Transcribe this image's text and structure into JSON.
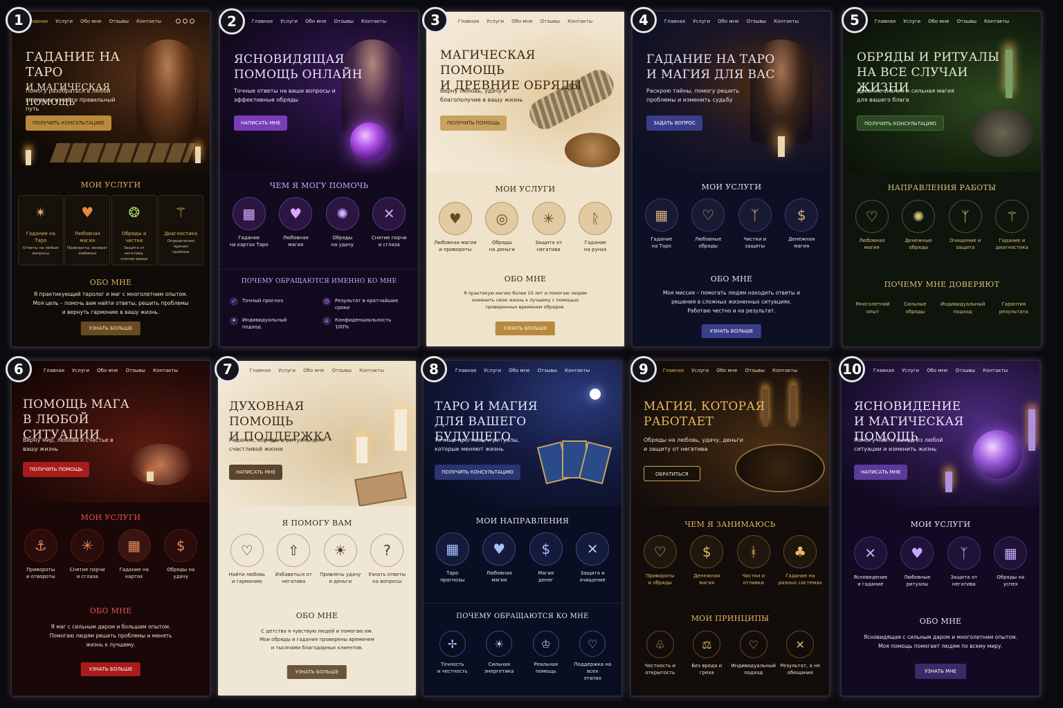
{
  "cards": [
    {
      "number": "1",
      "nav": [
        "Главная",
        "Услуги",
        "Обо мне",
        "Отзывы",
        "Контакты"
      ],
      "title_line1": "Гадание на Таро",
      "title_line2": "и магическая помощь",
      "subtitle": "Помогу разобраться в любой ситуации и найти правильный путь",
      "cta": "Получить консультацию",
      "services_title": "Мои услуги",
      "services": [
        {
          "label": "Гадание на Таро",
          "desc": "Ответы на любые\nвопросы",
          "icon": "tarot-icon"
        },
        {
          "label": "Любовная магия",
          "desc": "Привороты, возврат\nлюбимых",
          "icon": "heart-icon"
        },
        {
          "label": "Обряды и чистки",
          "desc": "Защита от негатива,\nснятие вреда",
          "icon": "ritual-icon"
        },
        {
          "label": "Диагностика",
          "desc": "Определение причин\nпроблем",
          "icon": "diagnostics-icon"
        }
      ],
      "about_title": "Обо мне",
      "about_text": "Я практикующий таролог и маг с многолетним опытом.\nМоя цель – помочь вам найти ответы, решить проблемы\nи вернуть гармонию в вашу жизнь.",
      "more": "Узнать больше"
    },
    {
      "number": "2",
      "nav": [
        "Главная",
        "Услуги",
        "Обо мне",
        "Отзывы",
        "Контакты"
      ],
      "title_line1": "Ясновидящая",
      "title_line2": "помощь онлайн",
      "subtitle": "Точные ответы на ваши вопросы и эффективные обряды",
      "cta": "Написать мне",
      "services_title": "Чем я могу помочь",
      "services": [
        {
          "label": "Гадание\nна картах Таро",
          "icon": "tarot-icon"
        },
        {
          "label": "Любовная\nмагия",
          "icon": "heart-icon"
        },
        {
          "label": "Обряды\nна удачу",
          "icon": "luck-icon"
        },
        {
          "label": "Снятие порчи\nи сглаза",
          "icon": "arrows-icon"
        }
      ],
      "why_title": "Почему обращаются именно ко мне",
      "reasons": [
        "Точный прогноз",
        "Результат в кратчайшие сроки",
        "Индивидуальный\nподход",
        "Конфиденциальность\n100%"
      ]
    },
    {
      "number": "3",
      "nav": [
        "Главная",
        "Услуги",
        "Обо мне",
        "Отзывы",
        "Контакты"
      ],
      "title_line1": "Магическая помощь",
      "title_line2": "и древние обряды",
      "subtitle": "Верну любовь, удачу и благополучие в вашу жизнь",
      "cta": "Получить помощь",
      "services_title": "Мои услуги",
      "services": [
        {
          "label": "Любовная магия\nи привороты",
          "icon": "heart-icon"
        },
        {
          "label": "Обряды\nна деньги",
          "icon": "money-icon"
        },
        {
          "label": "Защита от\nнегатива",
          "icon": "shield-icon"
        },
        {
          "label": "Гадание\nна рунах",
          "icon": "rune-icon"
        }
      ],
      "about_title": "Обо мне",
      "about_text": "Я практикую магию более 10 лет и помогаю людям\nизменить свою жизнь к лучшему с помощью\nпроверенных временем обрядов.",
      "more": "Узнать больше"
    },
    {
      "number": "4",
      "nav": [
        "Главная",
        "Услуги",
        "Обо мне",
        "Отзывы",
        "Контакты"
      ],
      "title_line1": "Гадание на Таро",
      "title_line2": "и магия для вас",
      "subtitle": "Раскрою тайны, помогу решить проблемы и изменить судьбу",
      "cta": "Задать вопрос",
      "services_title": "Мои услуги",
      "services": [
        {
          "label": "Гадание\nна Таро",
          "icon": "tarot-icon"
        },
        {
          "label": "Любовные\nобряды",
          "icon": "heart-icon"
        },
        {
          "label": "Чистки и\nзащиты",
          "icon": "shield-icon"
        },
        {
          "label": "Денежная\nмагия",
          "icon": "money-icon"
        }
      ],
      "about_title": "Обо мне",
      "about_text": "Моя миссия – помогать людям находить ответы и\nрешения в сложных жизненных ситуациях.\nРаботаю честно и на результат.",
      "more": "Узнать больше"
    },
    {
      "number": "5",
      "nav": [
        "Главная",
        "Услуги",
        "Обо мне",
        "Отзывы",
        "Контакты"
      ],
      "title_line1": "Обряды и ритуалы",
      "title_line2": "на все случаи жизни",
      "subtitle": "Древние знания и сильная магия для вашего блага",
      "cta": "Получить консультацию",
      "services_title": "Направления работы",
      "services": [
        {
          "label": "Любовная\nмагия",
          "icon": "heart-icon"
        },
        {
          "label": "Денежные\nобряды",
          "icon": "money-icon"
        },
        {
          "label": "Очищение и\nзащита",
          "icon": "shield-icon"
        },
        {
          "label": "Гадание и\nдиагностика",
          "icon": "diagnostics-icon"
        }
      ],
      "why_title": "Почему мне доверяют",
      "trust": [
        "Многолетний\nопыт",
        "Сильные\nобряды",
        "Индивидуальный\nподход",
        "Гарантия\nрезультата"
      ]
    },
    {
      "number": "6",
      "nav": [
        "Главная",
        "Услуги",
        "Обо мне",
        "Отзывы",
        "Контакты"
      ],
      "title_line1": "Помощь мага",
      "title_line2": "в любой ситуации",
      "subtitle": "Верну мир, любовь и счастье в вашу жизнь",
      "cta": "Получить помощь",
      "services_title": "Мои услуги",
      "services": [
        {
          "label": "Привороты\nи отвороты",
          "icon": "ritual-icon"
        },
        {
          "label": "Снятие порчи\nи сглаза",
          "icon": "arrows-icon"
        },
        {
          "label": "Гадание на\nкартах",
          "icon": "tarot-icon"
        },
        {
          "label": "Обряды на\nудачу",
          "icon": "money-icon"
        }
      ],
      "about_title": "Обо мне",
      "about_text": "Я маг с сильным даром и большим опытом.\nПомогаю людям решать проблемы и менять\nжизнь к лучшему.",
      "more": "Узнать больше"
    },
    {
      "number": "7",
      "nav": [
        "Главная",
        "Услуги",
        "Обо мне",
        "Отзывы",
        "Контакты"
      ],
      "title_line1": "Духовная помощь",
      "title_line2": "и поддержка",
      "subtitle": "Гадание, обряды и ритуалы для счастливой жизни",
      "cta": "Написать мне",
      "services_title": "Я помогу вам",
      "services": [
        {
          "label": "Найти любовь\nи гармонию",
          "icon": "heart-icon"
        },
        {
          "label": "Избавиться от\nнегатива",
          "icon": "shield-icon"
        },
        {
          "label": "Привлечь удачу\nи деньги",
          "icon": "sun-icon"
        },
        {
          "label": "Узнать ответы\nна вопросы",
          "icon": "question-icon"
        }
      ],
      "about_title": "Обо мне",
      "about_text": "С детства я чувствую людей и помогаю им.\nМои обряды и гадания проверены временем\nи тысячами благодарных клиентов.",
      "more": "Узнать больше"
    },
    {
      "number": "8",
      "nav": [
        "Главная",
        "Услуги",
        "Обо мне",
        "Отзывы",
        "Контакты"
      ],
      "title_line1": "Таро и магия",
      "title_line2": "для вашего будущего",
      "subtitle": "Точные прогнозы и ритуалы, которые меняют жизнь",
      "cta": "Получить консультацию",
      "services_title": "Мои направления",
      "services": [
        {
          "label": "Таро\nпрогнозы",
          "icon": "tarot-icon"
        },
        {
          "label": "Любовная\nмагия",
          "icon": "heart-icon"
        },
        {
          "label": "Магия\nденег",
          "icon": "money-icon"
        },
        {
          "label": "Защита и\nочищение",
          "icon": "arrows-icon"
        }
      ],
      "why_title": "Почему обращаются ко мне",
      "why": [
        {
          "label": "Точность\nи честность",
          "icon": "compass-icon"
        },
        {
          "label": "Сильная\nэнергетика",
          "icon": "sun-icon"
        },
        {
          "label": "Реальная\nпомощь",
          "icon": "crown-icon"
        },
        {
          "label": "Поддержка на всех\nэтапах",
          "icon": "heart-icon"
        }
      ]
    },
    {
      "number": "9",
      "nav": [
        "Главная",
        "Услуги",
        "Обо мне",
        "Отзывы",
        "Контакты"
      ],
      "title_line1": "Магия, которая",
      "title_line2": "работает",
      "subtitle": "Обряды на любовь, удачу, деньги и защиту от негатива",
      "cta": "Обратиться",
      "services_title": "Чем я занимаюсь",
      "services": [
        {
          "label": "Привороты\nи обряды",
          "icon": "heart-icon"
        },
        {
          "label": "Денежная\nмагия",
          "icon": "money-icon"
        },
        {
          "label": "Чистки и\nотливки",
          "icon": "rune-icon"
        },
        {
          "label": "Гадание на\nразных системах",
          "icon": "tree-icon"
        }
      ],
      "why_title": "Мои принципы",
      "why": [
        {
          "label": "Честность и\nоткрытость",
          "icon": "ritual-icon"
        },
        {
          "label": "Без вреда и\nгреха",
          "icon": "scales-icon"
        },
        {
          "label": "Индивидуальный\nподход",
          "icon": "heart-icon"
        },
        {
          "label": "Результат, а не\nобещания",
          "icon": "arrows-icon"
        }
      ]
    },
    {
      "number": "10",
      "nav": [
        "Главная",
        "Услуги",
        "Обо мне",
        "Отзывы",
        "Контакты"
      ],
      "title_line1": "Ясновидение",
      "title_line2": "и магическая помощь",
      "subtitle": "Помогу найти выход из любой ситуации и изменить жизнь",
      "cta": "Написать мне",
      "services_title": "Мои услуги",
      "services": [
        {
          "label": "Ясновидение\nи гадание",
          "icon": "arrows-icon"
        },
        {
          "label": "Любовные\nритуалы",
          "icon": "heart-icon"
        },
        {
          "label": "Защита от\nнегатива",
          "icon": "shield-icon"
        },
        {
          "label": "Обряды на\nуспех",
          "icon": "tarot-icon"
        }
      ],
      "about_title": "Обо мне",
      "about_text": "Ясновидящая с сильным даром и многолетним опытом.\nМоя помощь помогает людям по всему миру.",
      "more": "Узнать мне"
    }
  ]
}
